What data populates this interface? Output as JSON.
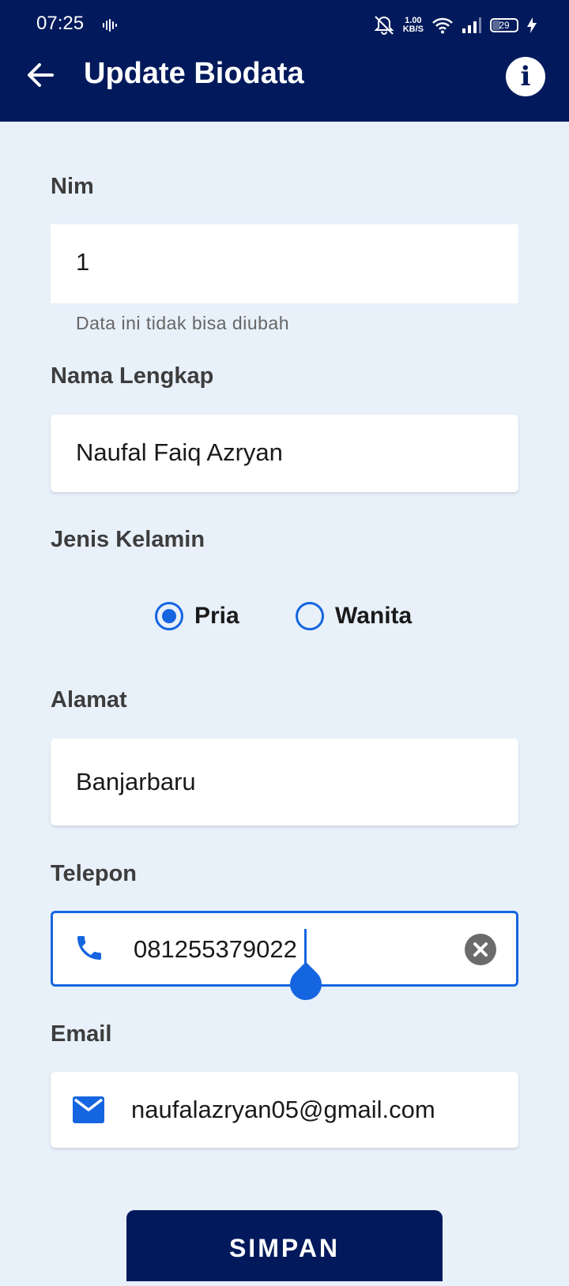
{
  "status_bar": {
    "time": "07:25",
    "speed_value": "1.00",
    "speed_unit": "KB/S",
    "battery": "29"
  },
  "app_bar": {
    "title": "Update Biodata",
    "info_glyph": "i"
  },
  "form": {
    "nim": {
      "label": "Nim",
      "value": "1",
      "helper": "Data ini tidak bisa diubah"
    },
    "nama": {
      "label": "Nama Lengkap",
      "value": "Naufal Faiq Azryan"
    },
    "gender": {
      "label": "Jenis Kelamin",
      "options": [
        {
          "label": "Pria",
          "selected": true
        },
        {
          "label": "Wanita",
          "selected": false
        }
      ]
    },
    "alamat": {
      "label": "Alamat",
      "value": "Banjarbaru"
    },
    "telepon": {
      "label": "Telepon",
      "value": "081255379022",
      "icon": "phone-icon"
    },
    "email": {
      "label": "Email",
      "value": "naufalazryan05@gmail.com",
      "icon": "mail-icon"
    }
  },
  "actions": {
    "save_label": "SIMPAN"
  },
  "colors": {
    "primary": "#021a5c",
    "accent": "#1565e0",
    "background": "#e8f0fa"
  }
}
